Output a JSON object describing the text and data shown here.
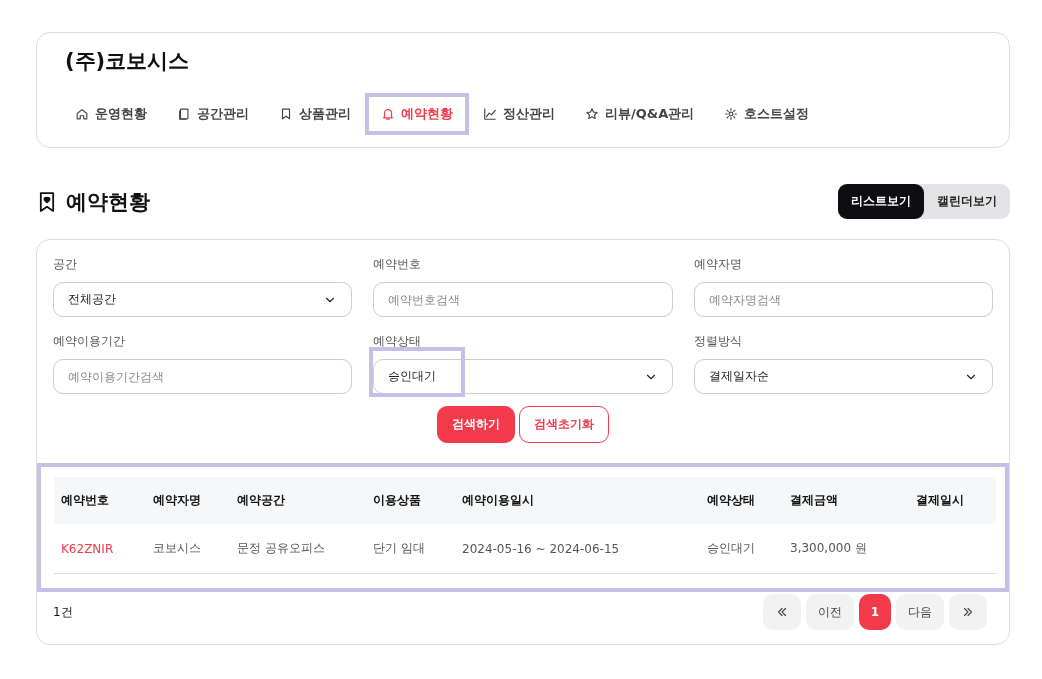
{
  "header": {
    "company": "(주)코보시스",
    "tabs": [
      {
        "label": "운영현황",
        "selected": false,
        "highlighted": false
      },
      {
        "label": "공간관리",
        "selected": false,
        "highlighted": false
      },
      {
        "label": "상품관리",
        "selected": false,
        "highlighted": false
      },
      {
        "label": "예약현황",
        "selected": true,
        "highlighted": true
      },
      {
        "label": "정산관리",
        "selected": false,
        "highlighted": false
      },
      {
        "label": "리뷰/Q&A관리",
        "selected": false,
        "highlighted": false
      },
      {
        "label": "호스트설정",
        "selected": false,
        "highlighted": false
      }
    ]
  },
  "page": {
    "title": "예약현황",
    "views": [
      {
        "label": "리스트보기",
        "selected": true
      },
      {
        "label": "캘린더보기",
        "selected": false
      }
    ]
  },
  "filters": [
    {
      "kind": "select",
      "label": "공간",
      "value": "전체공간",
      "highlighted": false
    },
    {
      "kind": "input",
      "label": "예약번호",
      "placeholder": "예약번호검색",
      "highlighted": false
    },
    {
      "kind": "input",
      "label": "예약자명",
      "placeholder": "예약자명검색",
      "highlighted": false
    },
    {
      "kind": "input",
      "label": "예약이용기간",
      "placeholder": "예약이용기간검색",
      "highlighted": false
    },
    {
      "kind": "select",
      "label": "예약상태",
      "value": "승인대기",
      "highlighted": true
    },
    {
      "kind": "select",
      "label": "정렬방식",
      "value": "결제일자순",
      "highlighted": false
    }
  ],
  "actions": {
    "search": "검색하기",
    "reset": "검색초기화"
  },
  "table": {
    "highlighted": true,
    "columns": [
      "예약번호",
      "예약자명",
      "예약공간",
      "이용상품",
      "예약이용일시",
      "예약상태",
      "결제금액",
      "결제일시"
    ],
    "rows": [
      [
        "K62ZNIR",
        "코보시스",
        "문정 공유오피스",
        "단기 임대",
        "2024-05-16 ~ 2024-06-15",
        "승인대기",
        "3,300,000 원",
        ""
      ]
    ]
  },
  "footer": {
    "count": "1건",
    "pages": [
      {
        "label": "1",
        "selected": true
      }
    ],
    "prev": "이전",
    "next": "다음"
  }
}
